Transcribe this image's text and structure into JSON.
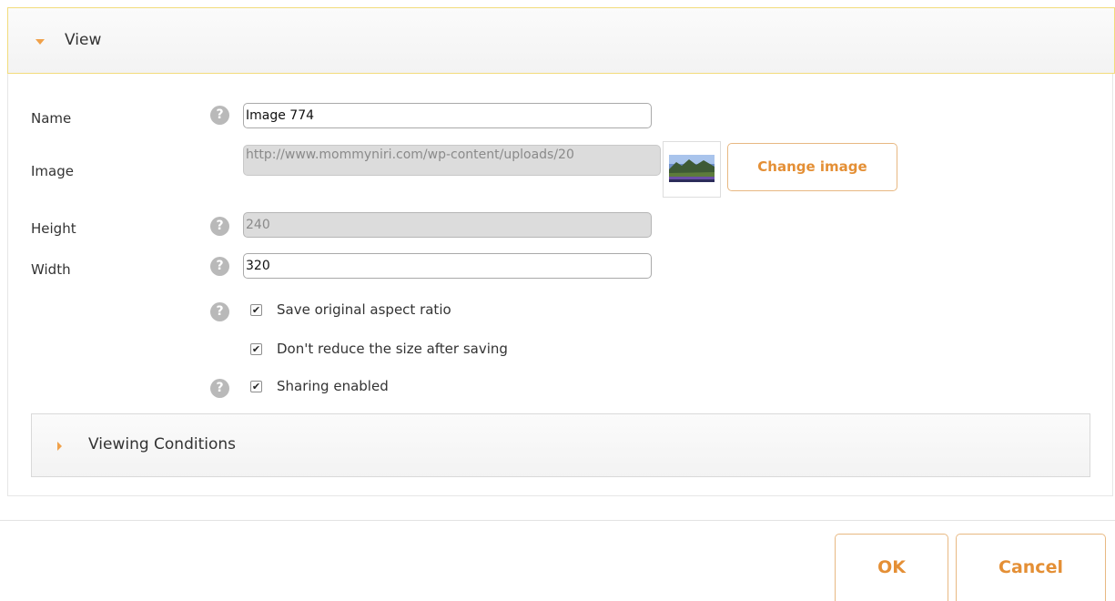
{
  "view_section": {
    "title": "View",
    "expanded": true
  },
  "form": {
    "name_label": "Name",
    "name_value": "Image 774",
    "image_label": "Image",
    "image_url": "http://www.mommyniri.com/wp-content/uploads/20",
    "change_image_label": "Change image",
    "height_label": "Height",
    "height_value": "240",
    "width_label": "Width",
    "width_value": "320",
    "help_glyph": "?",
    "checkboxes": [
      {
        "label": "Save original aspect ratio",
        "checked": true
      },
      {
        "label": "Don't reduce the size after saving",
        "checked": true
      },
      {
        "label": "Sharing enabled",
        "checked": true
      }
    ]
  },
  "viewing_conditions": {
    "title": "Viewing Conditions",
    "expanded": false
  },
  "footer": {
    "ok_label": "OK",
    "cancel_label": "Cancel"
  },
  "colors": {
    "accent": "#e48f35",
    "header_border": "#f2dc7b",
    "help_icon": "#b9b9b9"
  },
  "icons": {
    "help": "help-icon",
    "expand": "caret-down-icon",
    "collapse": "caret-right-icon",
    "check": "checkmark-icon"
  }
}
